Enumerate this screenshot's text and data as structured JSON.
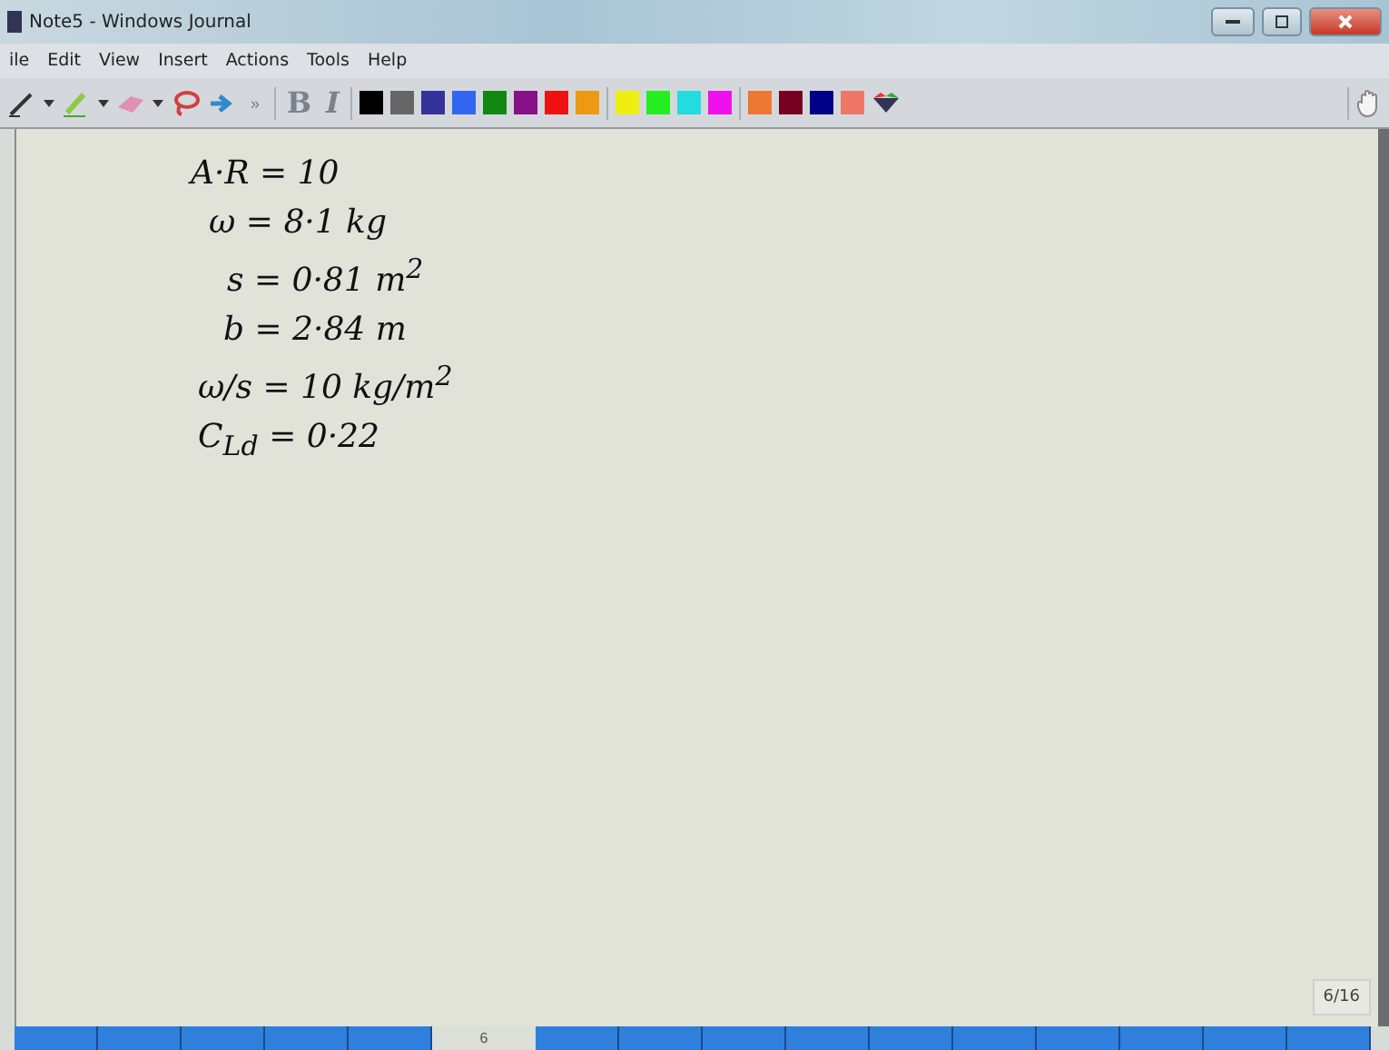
{
  "window": {
    "title": "Note5 - Windows Journal"
  },
  "menu": [
    "ile",
    "Edit",
    "View",
    "Insert",
    "Actions",
    "Tools",
    "Help"
  ],
  "toolbar": {
    "overflow": "»",
    "bold": "B",
    "italic": "I",
    "swatches": [
      {
        "color": "#000000"
      },
      {
        "color": "#666666"
      },
      {
        "color": "#333399"
      },
      {
        "color": "#3366ee"
      },
      {
        "color": "#118811"
      },
      {
        "color": "#881188"
      },
      {
        "color": "#ee1111"
      },
      {
        "color": "#ee9911"
      },
      {
        "color": "#eeee11"
      },
      {
        "color": "#22ee22"
      },
      {
        "color": "#22dddd"
      },
      {
        "color": "#ee11ee"
      },
      {
        "color": "#ee7733"
      },
      {
        "color": "#770022"
      },
      {
        "color": "#000088"
      },
      {
        "color": "#ee7766"
      }
    ]
  },
  "notes": [
    "A·R = 10",
    "ω = 8·1 kg",
    "s = 0·81 m$^{2}$",
    "b = 2·84 m",
    "ω/s = 10 kg/m$^{2}$",
    "C$_{Ld}$ = 0·22"
  ],
  "page_indicator": "6/16",
  "page_tabs": [
    {
      "selected": false
    },
    {
      "selected": false
    },
    {
      "selected": false
    },
    {
      "selected": false
    },
    {
      "selected": false
    },
    {
      "label": "6",
      "selected": true
    },
    {
      "selected": false
    },
    {
      "selected": false
    },
    {
      "selected": false
    },
    {
      "selected": false
    },
    {
      "selected": false
    },
    {
      "selected": false
    },
    {
      "selected": false
    },
    {
      "selected": false
    },
    {
      "selected": false
    },
    {
      "selected": false
    }
  ]
}
